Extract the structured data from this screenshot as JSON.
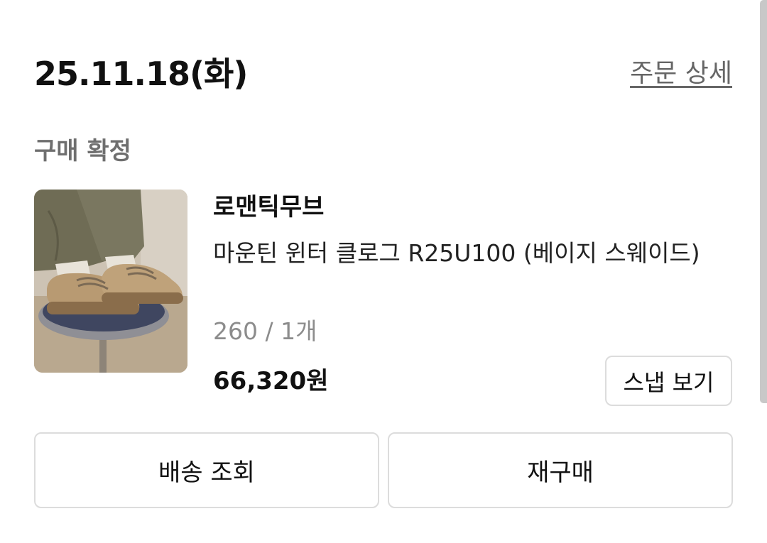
{
  "order": {
    "date": "25.11.18(화)",
    "detail_link": "주문 상세",
    "status": "구매 확정"
  },
  "product": {
    "image_icon": "product-photo-suede-clogs",
    "brand": "로맨틱무브",
    "name": "마운틴 윈터 클로그 R25U100 (베이지 스웨이드)",
    "option": "260 / 1개",
    "price": "66,320원",
    "snap_button": "스냅 보기"
  },
  "actions": {
    "track_delivery": "배송 조회",
    "rebuy": "재구매"
  },
  "colors": {
    "status_text": "#6f6f6f",
    "option_text": "#8c8c8c",
    "border": "#dcdcdc"
  }
}
